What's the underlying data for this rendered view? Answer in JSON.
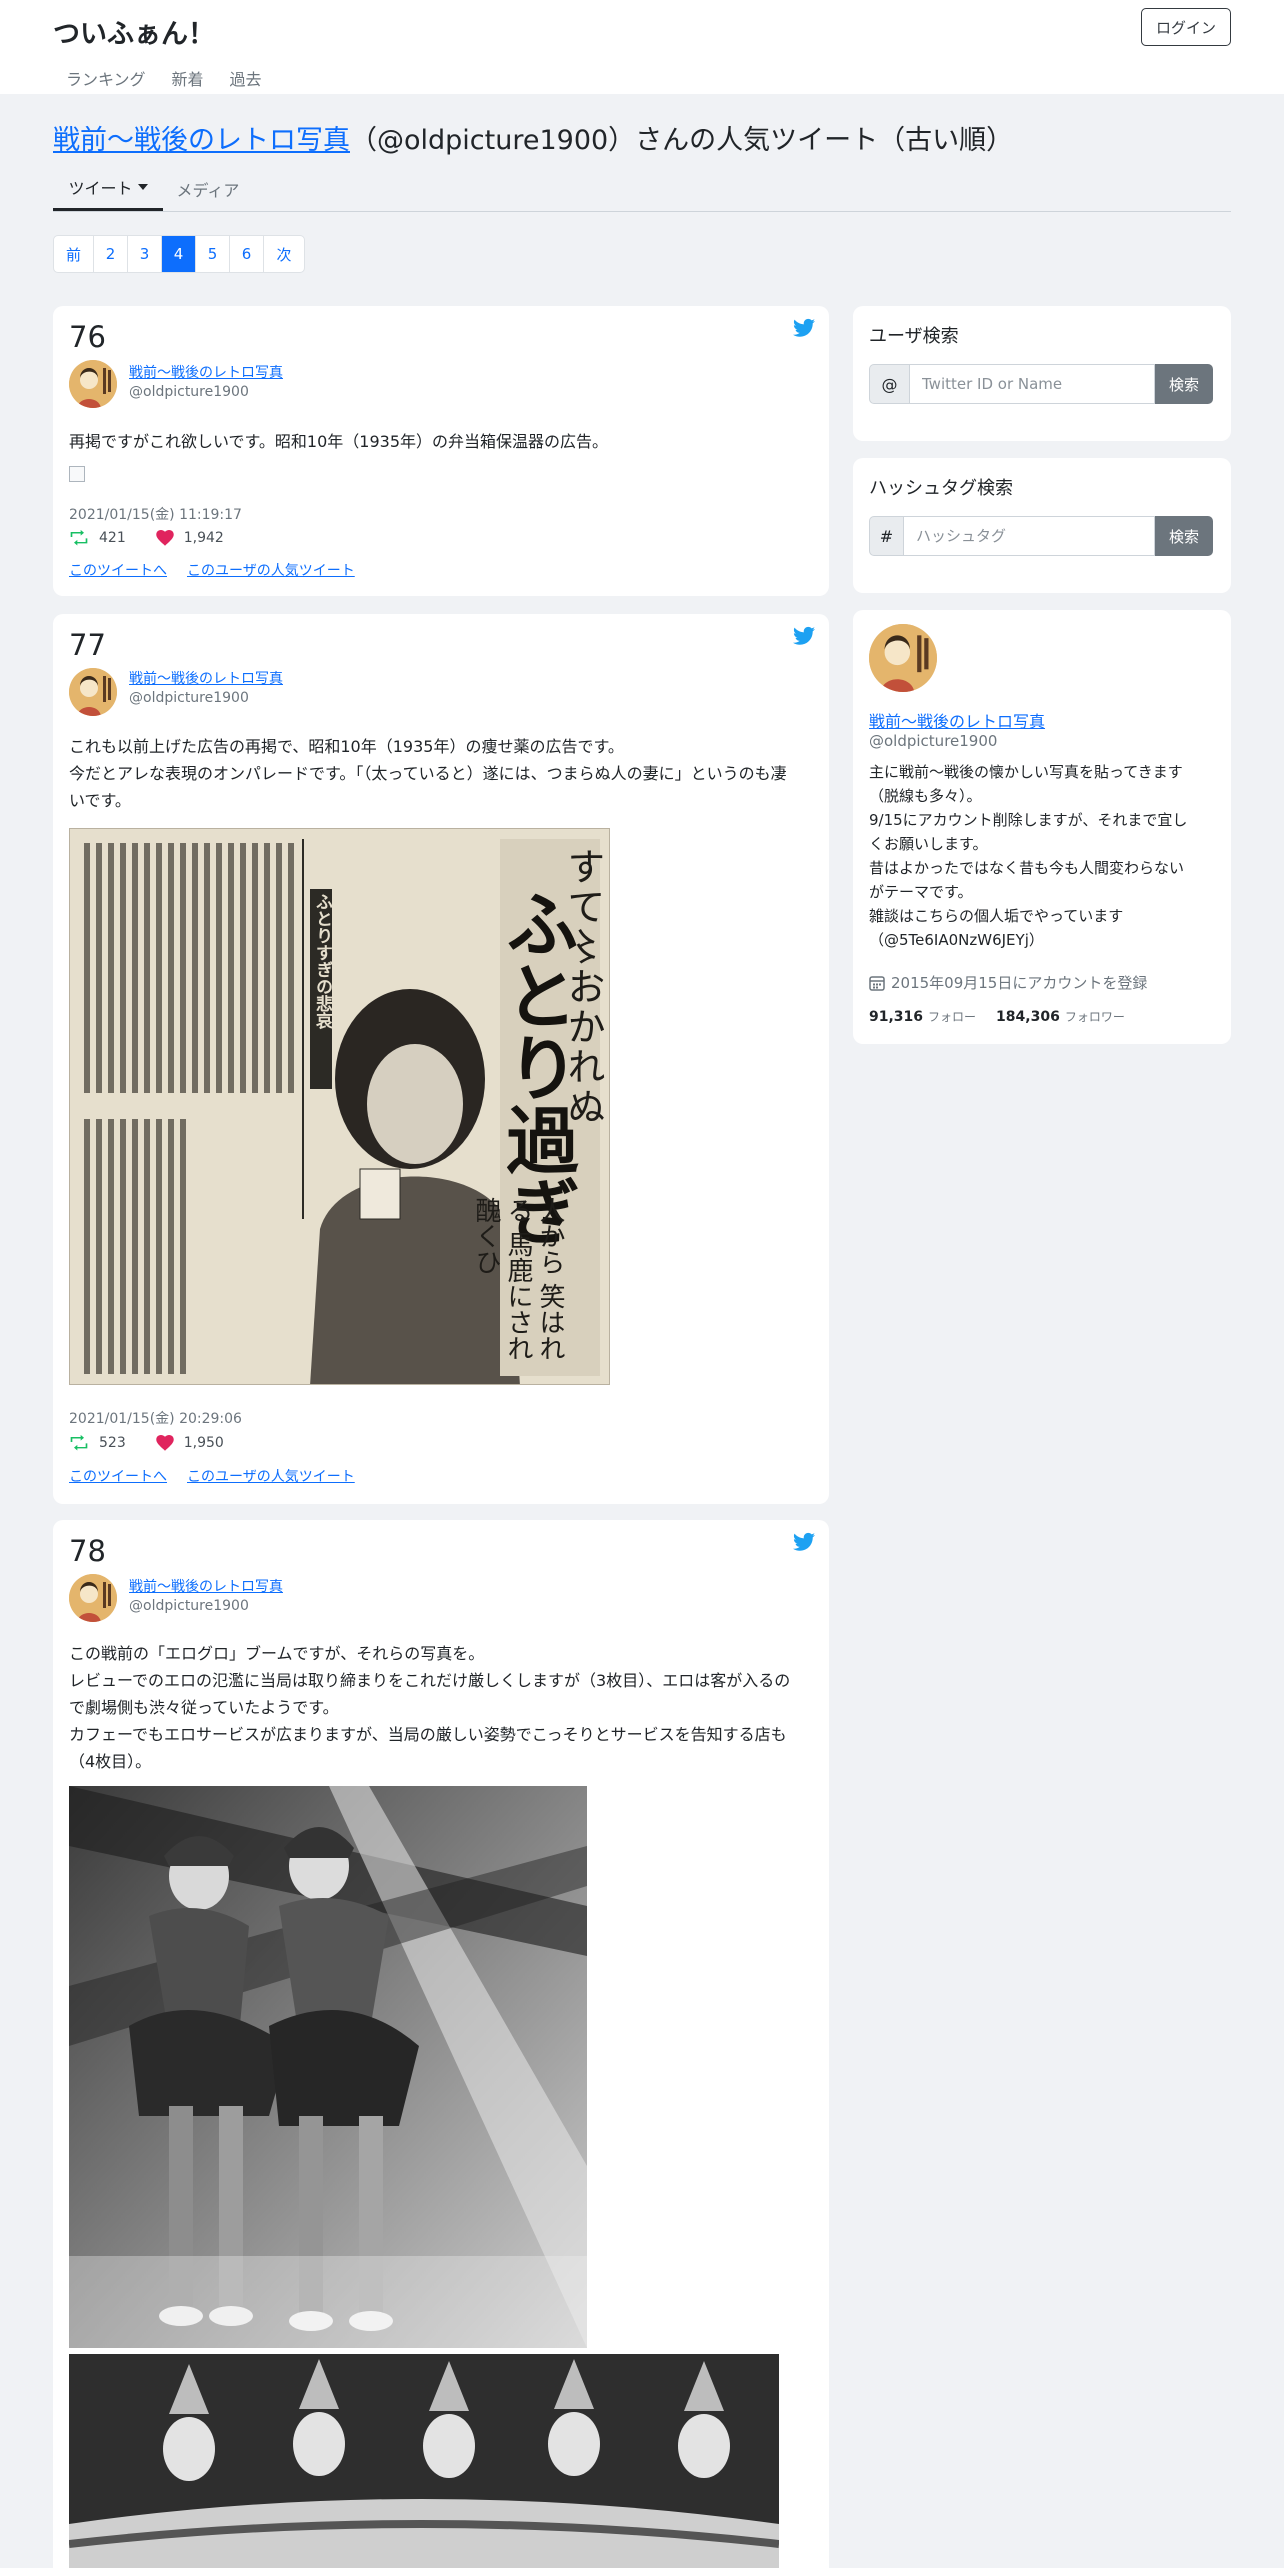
{
  "site": {
    "brand": "ついふぁん！",
    "login_label": "ログイン",
    "nav": [
      "ランキング",
      "新着",
      "過去"
    ]
  },
  "heading": {
    "user_name": "戦前～戦後のレトロ写真",
    "rest": "（@oldpicture1900）さんの人気ツイート（古い順）"
  },
  "tabs": {
    "tweet": "ツイート",
    "media": "メディア"
  },
  "pagination": {
    "prev": "前",
    "pages": [
      "2",
      "3",
      "4",
      "5",
      "6"
    ],
    "active": "4",
    "next": "次"
  },
  "tweets": [
    {
      "rank": "76",
      "author": "戦前～戦後のレトロ写真",
      "handle": "@oldpicture1900",
      "text": [
        "再掲ですがこれ欲しいです。昭和10年（1935年）の弁当箱保温器の広告。"
      ],
      "date": "2021/01/15(金) 11:19:17",
      "retweets": "421",
      "likes": "1,942",
      "link_tweet": "このツイートへ",
      "link_user": "このユーザの人気ツイート"
    },
    {
      "rank": "77",
      "author": "戦前～戦後のレトロ写真",
      "handle": "@oldpicture1900",
      "text": [
        "これも以前上げた広告の再掲で、昭和10年（1935年）の痩せ薬の広告です。",
        "今だとアレな表現のオンパレードです。「（太っていると）遂には、つまらぬ人の妻に」というのも凄",
        "いです。"
      ],
      "date": "2021/01/15(金) 20:29:06",
      "retweets": "523",
      "likes": "1,950",
      "link_tweet": "このツイートへ",
      "link_user": "このユーザの人気ツイート",
      "ad_headline": "ふとり過ぎ",
      "ad_top": "すて〻おかれぬ",
      "ad_sub": "人から 笑はれる 馬鹿にされ 醜くひ",
      "ad_caption": "ふとりすぎの悲哀"
    },
    {
      "rank": "78",
      "author": "戦前～戦後のレトロ写真",
      "handle": "@oldpicture1900",
      "text": [
        "この戦前の「エログロ」ブームですが、それらの写真を。",
        "レビューでのエロの氾濫に当局は取り締まりをこれだけ厳しくしますが（3枚目）、エロは客が入るの",
        "で劇場側も渋々従っていたようです。",
        "カフェーでもエロサービスが広まりますが、当局の厳しい姿勢でこっそりとサービスを告知する店も",
        "（4枚目）。"
      ]
    }
  ],
  "sidebar": {
    "user_search": {
      "title": "ユーザ検索",
      "prefix": "@",
      "placeholder": "Twitter ID or Name",
      "button": "検索"
    },
    "hashtag_search": {
      "title": "ハッシュタグ検索",
      "prefix": "#",
      "placeholder": "ハッシュタグ",
      "button": "検索"
    },
    "profile": {
      "name": "戦前～戦後のレトロ写真",
      "handle": "@oldpicture1900",
      "desc": [
        "主に戦前～戦後の懐かしい写真を貼ってきます",
        "（脱線も多々）。",
        "9/15にアカウント削除しますが、それまで宜し",
        "くお願いします。",
        "昔はよかったではなく昔も今も人間変わらない",
        "がテーマです。",
        "雑談はこちらの個人垢でやっています",
        "（@5Te6IA0NzW6JEYj）"
      ],
      "registered": "2015年09月15日にアカウントを登録",
      "follow_count": "91,316",
      "follow_label": "フォロー",
      "follower_count": "184,306",
      "follower_label": "フォロワー"
    }
  },
  "colors": {
    "accent": "#0d6efd",
    "retweet": "#17bf63",
    "like": "#e0245e",
    "twitter": "#1da1f2",
    "page_bg": "#f0f2f5"
  }
}
